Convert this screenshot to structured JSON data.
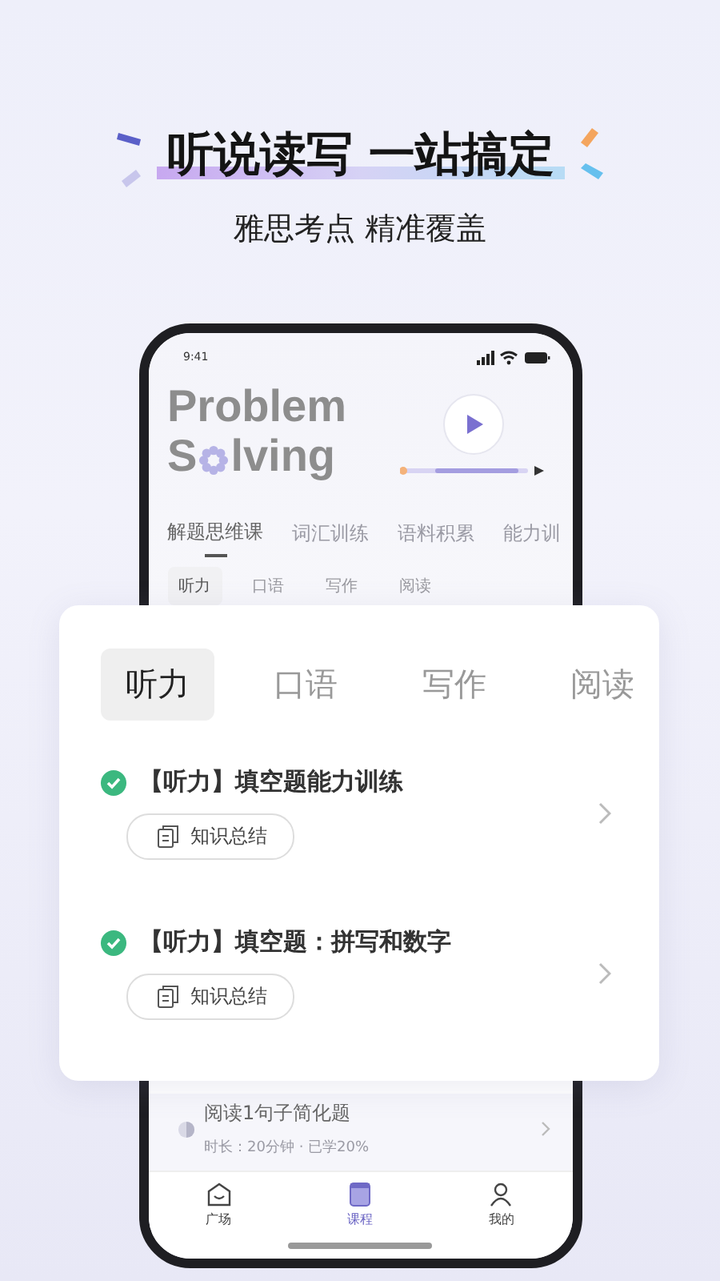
{
  "headline": "听说读写 一站搞定",
  "subheadline": "雅思考点 精准覆盖",
  "phone": {
    "status_time": "9:41",
    "hero": {
      "line1": "Problem",
      "line2_start": "S",
      "line2_end": "lving"
    },
    "course_tabs": [
      {
        "label": "解题思维课",
        "selected": true
      },
      {
        "label": "词汇训练",
        "selected": false
      },
      {
        "label": "语料积累",
        "selected": false
      },
      {
        "label": "能力训",
        "selected": false
      }
    ],
    "subject_tabs": [
      {
        "label": "听力",
        "selected": true
      },
      {
        "label": "口语",
        "selected": false
      },
      {
        "label": "写作",
        "selected": false
      },
      {
        "label": "阅读",
        "selected": false
      }
    ],
    "lesson": {
      "title": "阅读1句子简化题",
      "meta": "时长：20分钟 · 已学20%"
    },
    "bottom_nav": [
      {
        "label": "广场",
        "selected": false,
        "kind": "home"
      },
      {
        "label": "课程",
        "selected": true,
        "kind": "course"
      },
      {
        "label": "我的",
        "selected": false,
        "kind": "profile"
      }
    ]
  },
  "card": {
    "tabs": [
      {
        "label": "听力",
        "selected": true
      },
      {
        "label": "口语",
        "selected": false
      },
      {
        "label": "写作",
        "selected": false
      },
      {
        "label": "阅读",
        "selected": false
      }
    ],
    "items": [
      {
        "title": "【听力】填空题能力训练",
        "done": true,
        "tag": "知识总结"
      },
      {
        "title": "【听力】填空题：拼写和数字",
        "done": true,
        "tag": "知识总结"
      }
    ]
  }
}
